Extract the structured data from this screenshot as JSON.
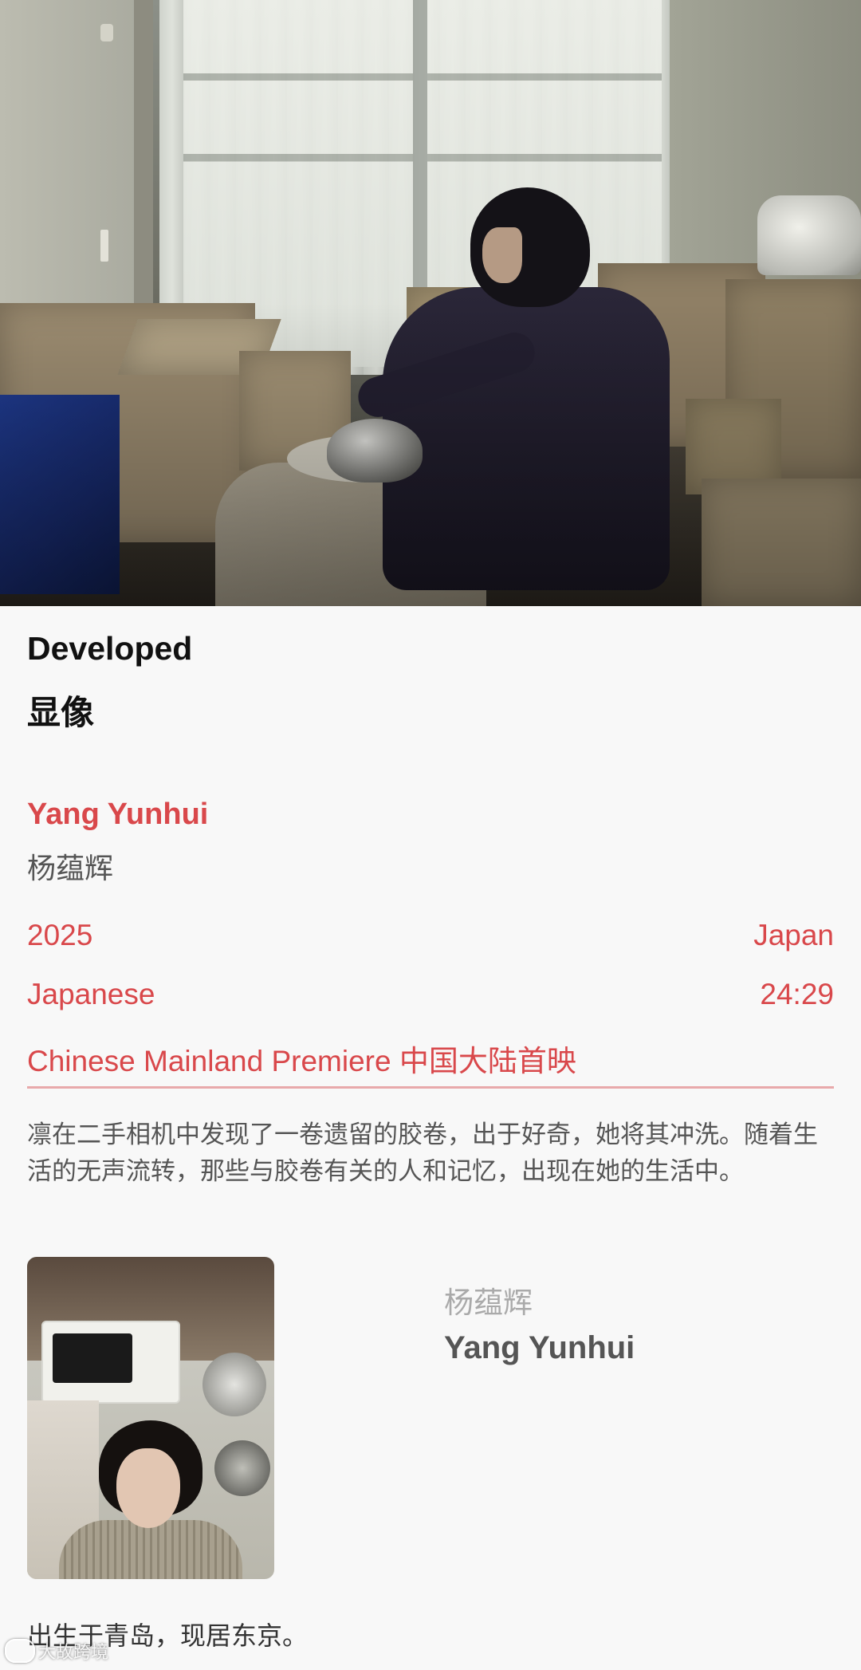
{
  "film": {
    "title_en": "Developed",
    "title_zh": "显像"
  },
  "director": {
    "name_en": "Yang Yunhui",
    "name_zh": "杨蕴辉"
  },
  "meta": {
    "year": "2025",
    "country": "Japan",
    "language": "Japanese",
    "runtime": "24:29",
    "premiere": "Chinese Mainland Premiere 中国大陆首映"
  },
  "synopsis": "凛在二手相机中发现了一卷遗留的胶卷，出于好奇，她将其冲洗。随着生活的无声流转，那些与胶卷有关的人和记忆，出现在她的生活中。",
  "director_card": {
    "name_zh": "杨蕴辉",
    "name_en": "Yang Yunhui",
    "bio": "出生于青岛，现居东京。"
  },
  "watermark": {
    "text": "大故跨境"
  },
  "colors": {
    "accent": "#d9484b",
    "divider": "#e8a9ab",
    "background": "#f8f8f8"
  }
}
